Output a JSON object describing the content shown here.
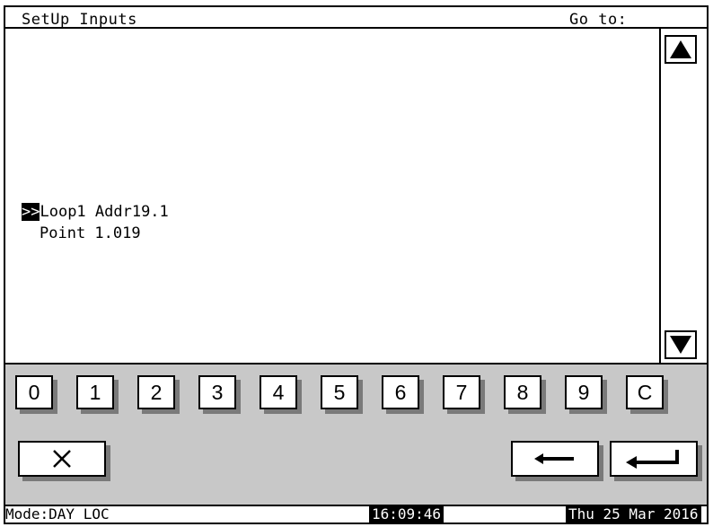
{
  "header": {
    "title": "SetUp Inputs",
    "goto_label": "Go to:"
  },
  "content": {
    "selection_marker": ">>",
    "line1": "Loop1 Addr19.1",
    "line2": "Point 1.019"
  },
  "scroll": {
    "up_icon": "triangle-up-icon",
    "down_icon": "triangle-down-icon"
  },
  "keypad": {
    "keys": [
      "0",
      "1",
      "2",
      "3",
      "4",
      "5",
      "6",
      "7",
      "8",
      "9",
      "C"
    ],
    "cancel_icon": "x-icon",
    "backspace_icon": "arrow-left-icon",
    "enter_icon": "enter-icon"
  },
  "status": {
    "mode": "Mode:DAY LOC",
    "time": "16:09:46",
    "date": "Thu 25 Mar 2016"
  },
  "colors": {
    "keypad_bg": "#c8c8c8",
    "key_shadow": "#7a7a7a"
  }
}
